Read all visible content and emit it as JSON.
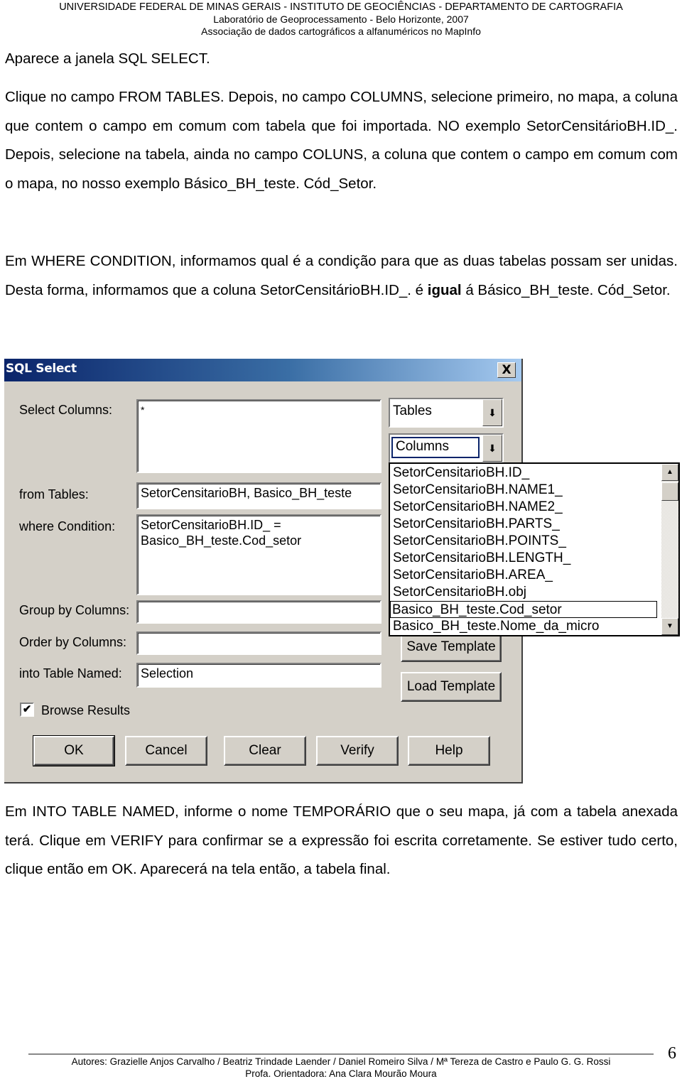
{
  "header": {
    "line1": "UNIVERSIDADE FEDERAL DE MINAS GERAIS - INSTITUTO DE GEOCIÊNCIAS - DEPARTAMENTO DE CARTOGRAFIA",
    "line2": "Laboratório de Geoprocessamento - Belo Horizonte, 2007",
    "line3": "Associação de dados cartográficos a alfanuméricos no MapInfo"
  },
  "paragraphs": {
    "p1": "Aparece a janela SQL SELECT.",
    "p2": "Clique no campo FROM TABLES. Depois, no campo COLUMNS, selecione primeiro, no mapa, a coluna que contem o campo em comum com tabela que foi importada. NO exemplo SetorCensitárioBH.ID_. Depois, selecione na tabela, ainda no campo COLUNS, a coluna que contem o campo em comum com o mapa, no nosso exemplo Básico_BH_teste. Cód_Setor.",
    "p3_start": "Em WHERE CONDITION, informamos qual é a condição para que as duas tabelas possam ser unidas. Desta forma, informamos que a coluna SetorCensitárioBH.ID_. é ",
    "p3_bold": "igual",
    "p3_end": " á Básico_BH_teste. Cód_Setor.",
    "p4": "Em INTO TABLE NAMED, informe o nome TEMPORÁRIO que o seu mapa, já com a tabela anexada terá. Clique em VERIFY para confirmar se a expressão foi escrita corretamente. Se estiver tudo certo, clique então em  OK. Aparecerá na tela então, a tabela final."
  },
  "dialog": {
    "title": "SQL Select",
    "close_label": "X",
    "labels": {
      "select_columns": "Select Columns:",
      "from_tables": "from Tables:",
      "where_condition": "where Condition:",
      "group_by": "Group by Columns:",
      "order_by": "Order by Columns:",
      "into_table": "into Table Named:",
      "browse_results": "Browse Results"
    },
    "values": {
      "select_columns": "*",
      "from_tables": "SetorCensitarioBH, Basico_BH_teste",
      "where_condition": "SetorCensitarioBH.ID_ =\nBasico_BH_teste.Cod_setor",
      "group_by": "",
      "order_by": "",
      "into_table": "Selection"
    },
    "browse_results_checked": true,
    "tables_combo": "Tables",
    "columns_combo": "Columns",
    "combo_arrow": "⬇",
    "columns_list": [
      "SetorCensitarioBH.ID_",
      "SetorCensitarioBH.NAME1_",
      "SetorCensitarioBH.NAME2_",
      "SetorCensitarioBH.PARTS_",
      "SetorCensitarioBH.POINTS_",
      "SetorCensitarioBH.LENGTH_",
      "SetorCensitarioBH.AREA_",
      "SetorCensitarioBH.obj",
      "Basico_BH_teste.Cod_setor",
      "Basico_BH_teste.Nome_da_micro"
    ],
    "selected_column": "Basico_BH_teste.Cod_setor",
    "buttons": {
      "save_template": "Save Template",
      "load_template": "Load Template",
      "ok": "OK",
      "cancel": "Cancel",
      "clear": "Clear",
      "verify": "Verify",
      "help": "Help"
    }
  },
  "footer": {
    "authors": "Autores: Grazielle Anjos Carvalho / Beatriz Trindade Laender / Daniel Romeiro Silva / Mª Tereza de Castro e Paulo G. G. Rossi",
    "advisor": "Profa. Orientadora: Ana Clara Mourão Moura",
    "page_number": "6"
  }
}
